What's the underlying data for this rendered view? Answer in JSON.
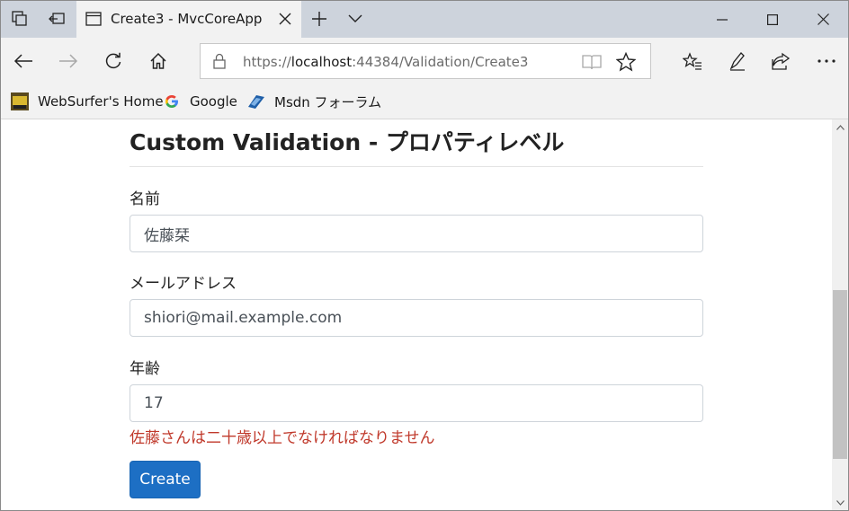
{
  "browser": {
    "tab_title": "Create3 - MvcCoreApp",
    "url_prefix": "https://",
    "url_host": "localhost",
    "url_rest": ":44384/Validation/Create3",
    "favorites": [
      {
        "label": "WebSurfer's Home",
        "icon": "websurfer-favicon"
      },
      {
        "label": "Google",
        "icon": "google-favicon"
      },
      {
        "label": "Msdn フォーラム",
        "icon": "msdn-favicon"
      }
    ]
  },
  "page": {
    "title": "Custom Validation - プロパティレベル",
    "fields": {
      "name": {
        "label": "名前",
        "value": "佐藤栞"
      },
      "email": {
        "label": "メールアドレス",
        "value": "shiori@mail.example.com"
      },
      "age": {
        "label": "年齢",
        "value": "17"
      }
    },
    "age_error": "佐藤さんは二十歳以上でなければなりません",
    "create_label": "Create"
  },
  "colors": {
    "accent": "#1d6fc4",
    "error": "#c0392b",
    "titlebar": "#cdd3dc"
  }
}
